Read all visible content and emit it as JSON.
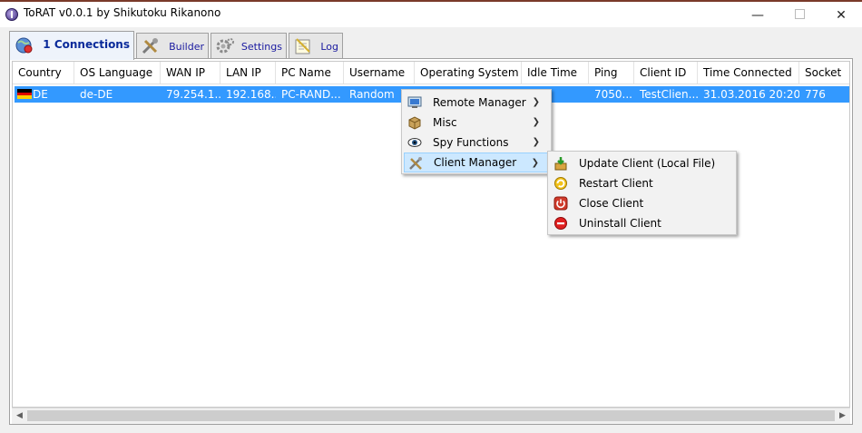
{
  "window": {
    "title": "ToRAT v0.0.1 by Shikutoku Rikanono"
  },
  "tabs": [
    {
      "label": "1 Connections",
      "active": true
    },
    {
      "label": "Builder"
    },
    {
      "label": "Settings"
    },
    {
      "label": "Log"
    }
  ],
  "table": {
    "columns": [
      "Country",
      "OS Language",
      "WAN IP",
      "LAN IP",
      "PC Name",
      "Username",
      "Operating System",
      "Idle Time",
      "Ping",
      "Client ID",
      "Time Connected",
      "Socket"
    ],
    "rows": [
      [
        "DE",
        "de-DE",
        "79.254.1...",
        "192.168....",
        "PC-RAND...",
        "Random",
        "",
        "",
        "7050...",
        "TestClien...",
        "31.03.2016 20:20:26",
        "776"
      ]
    ]
  },
  "context_menu": {
    "items": [
      {
        "label": "Remote Manager",
        "icon": "remote-manager-icon"
      },
      {
        "label": "Misc",
        "icon": "misc-box-icon"
      },
      {
        "label": "Spy Functions",
        "icon": "eye-icon"
      },
      {
        "label": "Client Manager",
        "icon": "client-manager-icon",
        "highlighted": true
      }
    ]
  },
  "submenu": {
    "items": [
      {
        "label": "Update Client (Local File)",
        "icon": "update-icon"
      },
      {
        "label": "Restart Client",
        "icon": "restart-icon"
      },
      {
        "label": "Close Client",
        "icon": "power-icon"
      },
      {
        "label": "Uninstall Client",
        "icon": "uninstall-icon"
      }
    ]
  },
  "colors": {
    "selection": "#3399ff",
    "menu_highlight": "#cce8ff"
  }
}
